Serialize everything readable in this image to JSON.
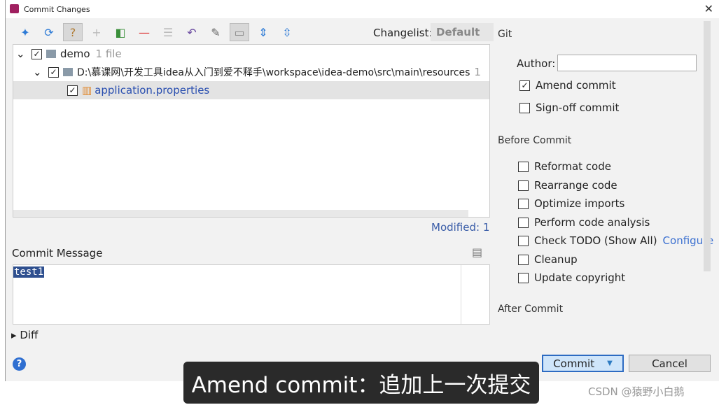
{
  "window": {
    "title": "Commit Changes"
  },
  "toolbar": {
    "icons": [
      "move-to-changelist-icon",
      "refresh-icon",
      "unversioned-icon",
      "add-icon",
      "show-diff-icon",
      "remove-icon",
      "group-icon",
      "rollback-icon",
      "edit-source-icon",
      "group-by-icon",
      "expand-all-icon",
      "collapse-all-icon"
    ],
    "changelist_label": "Changelist:",
    "changelist_value": "Default"
  },
  "tree": {
    "root": {
      "label": "demo",
      "count": "1 file"
    },
    "folder": {
      "label": "D:\\慕课网\\开发工具idea从入门到爱不释手\\workspace\\idea-demo\\src\\main\\resources",
      "count": "1"
    },
    "file": {
      "label": "application.properties"
    }
  },
  "modified": "Modified: 1",
  "commit_message": {
    "label": "Commit Message",
    "value": "test1"
  },
  "diff_label": "Diff",
  "git": {
    "section": "Git",
    "author_label": "Author:",
    "author_value": "",
    "amend": "Amend commit",
    "signoff": "Sign-off commit"
  },
  "before_commit": {
    "section": "Before Commit",
    "options": [
      "Reformat code",
      "Rearrange code",
      "Optimize imports",
      "Perform code analysis",
      "Check TODO (Show All)",
      "Cleanup",
      "Update copyright"
    ],
    "configure": "Configure"
  },
  "after_commit": {
    "section": "After Commit"
  },
  "buttons": {
    "commit": "Commit",
    "cancel": "Cancel",
    "help": "?"
  },
  "subtitle": "Amend commit：追加上一次提交",
  "watermark": "CSDN @猿野小白鹅"
}
